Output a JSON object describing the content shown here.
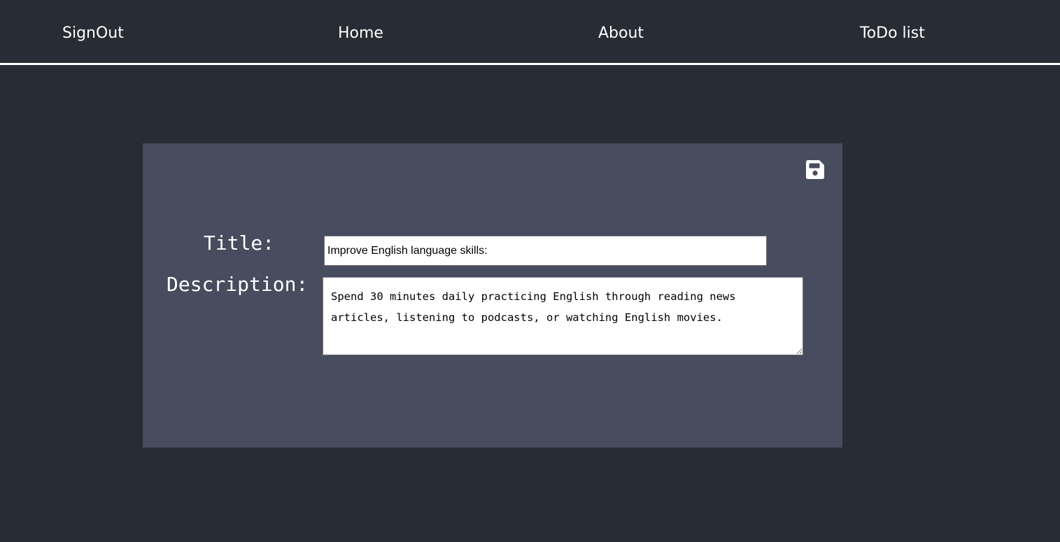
{
  "nav": {
    "signout_label": "SignOut",
    "home_label": "Home",
    "about_label": "About",
    "todo_label": "ToDo list"
  },
  "form": {
    "save_icon": "floppy-disk-save-icon",
    "title_label": "Title:",
    "description_label": "Description:",
    "title_value": "Improve English language skills:",
    "description_value": "Spend 30 minutes daily practicing English through reading news articles, listening to podcasts, or watching English movies."
  },
  "colors": {
    "background": "#282c34",
    "card": "#474c5e",
    "text": "#ffffff",
    "divider": "#ffffff"
  }
}
